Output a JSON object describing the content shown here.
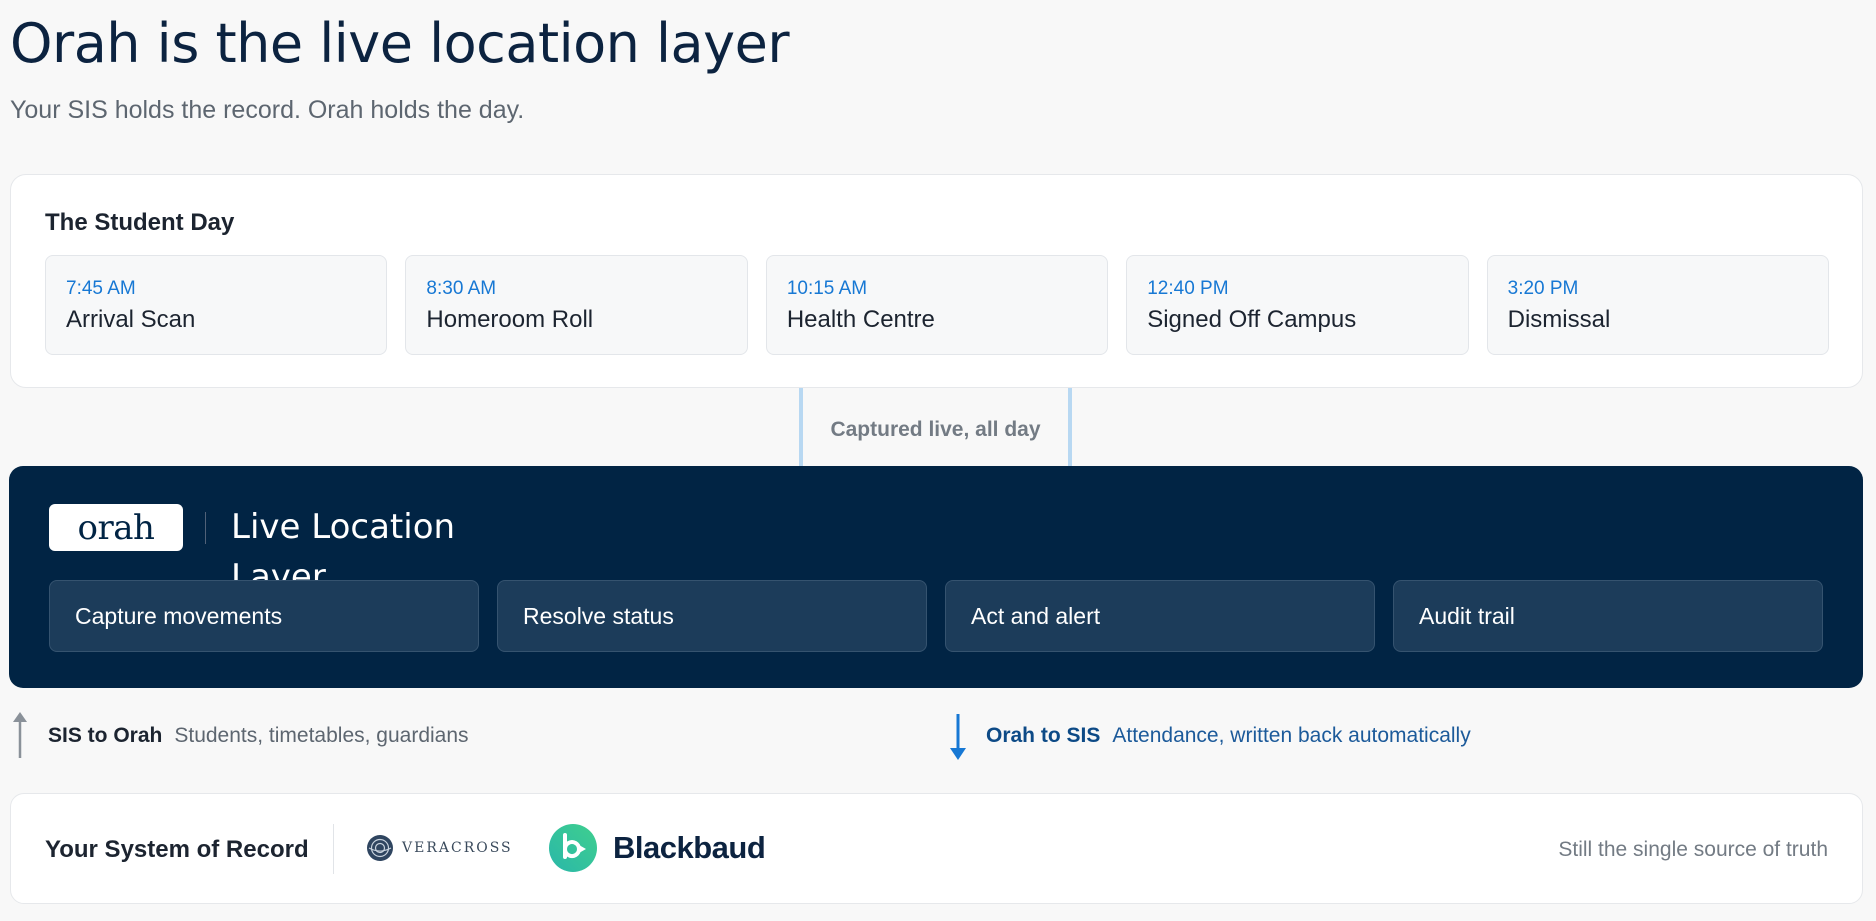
{
  "header": {
    "title": "Orah is the live location layer",
    "subtitle": "Your SIS holds the record. Orah holds the day."
  },
  "student_day": {
    "title": "The Student Day",
    "events": [
      {
        "time": "7:45 AM",
        "label": "Arrival Scan"
      },
      {
        "time": "8:30 AM",
        "label": "Homeroom Roll"
      },
      {
        "time": "10:15 AM",
        "label": "Health Centre"
      },
      {
        "time": "12:40 PM",
        "label": "Signed Off Campus"
      },
      {
        "time": "3:20 PM",
        "label": "Dismissal"
      }
    ]
  },
  "connector": {
    "text": "Captured live, all day"
  },
  "layer": {
    "logo": "orah",
    "title": "Live Location Layer",
    "capabilities": [
      "Capture movements",
      "Resolve status",
      "Act and alert",
      "Audit trail"
    ]
  },
  "flows": {
    "sis_to_orah": {
      "label": "SIS to Orah",
      "description": "Students, timetables, guardians"
    },
    "orah_to_sis": {
      "label": "Orah to SIS",
      "description": "Attendance, written back automatically"
    }
  },
  "record": {
    "title": "Your System of Record",
    "partners": [
      "VERACROSS",
      "Blackbaud"
    ],
    "note": "Still the single source of truth"
  },
  "colors": {
    "navy": "#012444",
    "accent_blue": "#1778d4",
    "card_bg": "#ffffff",
    "page_bg": "#f8f8f8"
  },
  "icons": {
    "up_arrow": "arrow-up-icon",
    "down_arrow": "arrow-down-icon",
    "veracross": "veracross-logo-icon",
    "blackbaud": "blackbaud-logo-icon"
  }
}
